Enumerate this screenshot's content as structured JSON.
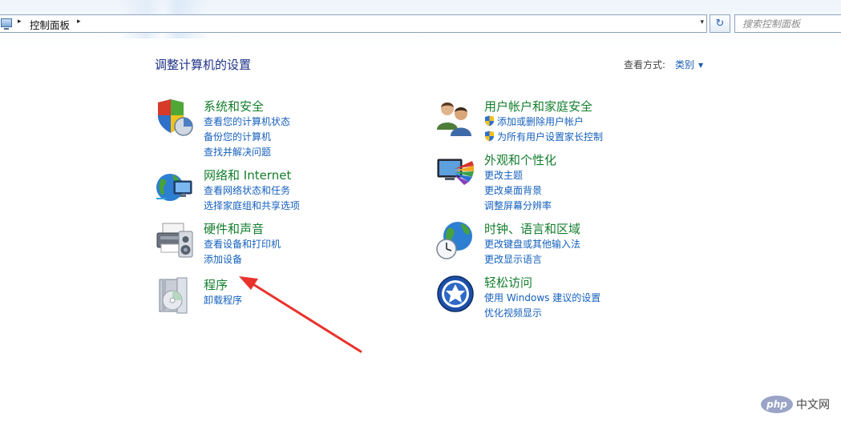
{
  "address_bar": {
    "breadcrumb": "控制面板",
    "separator": "▸",
    "dropdown": "▾"
  },
  "refresh_glyph": "↻",
  "search": {
    "placeholder": "搜索控制面板"
  },
  "page_title": "调整计算机的设置",
  "view_by": {
    "label": "查看方式:",
    "value": "类别"
  },
  "categories": [
    {
      "title": "系统和安全",
      "icon": "shield-pie-icon",
      "links": [
        "查看您的计算机状态",
        "备份您的计算机",
        "查找并解决问题"
      ]
    },
    {
      "title": "网络和 Internet",
      "icon": "globe-network-icon",
      "links": [
        "查看网络状态和任务",
        "选择家庭组和共享选项"
      ]
    },
    {
      "title": "硬件和声音",
      "icon": "printer-speaker-icon",
      "links": [
        "查看设备和打印机",
        "添加设备"
      ]
    },
    {
      "title": "程序",
      "icon": "programs-disc-icon",
      "links": [
        "卸载程序"
      ]
    },
    {
      "title": "用户帐户和家庭安全",
      "icon": "users-icon",
      "links": [
        "添加或删除用户帐户",
        "为所有用户设置家长控制"
      ]
    },
    {
      "title": "外观和个性化",
      "icon": "monitor-palette-icon",
      "links": [
        "更改主题",
        "更改桌面背景",
        "调整屏幕分辨率"
      ]
    },
    {
      "title": "时钟、语言和区域",
      "icon": "globe-clock-icon",
      "links": [
        "更改键盘或其他输入法",
        "更改显示语言"
      ]
    },
    {
      "title": "轻松访问",
      "icon": "accessibility-icon",
      "links": [
        "使用 Windows 建议的设置",
        "优化视频显示"
      ]
    }
  ],
  "colors": {
    "category_title": "#137e2d",
    "link": "#1560bd",
    "page_title": "#1e3287",
    "annotation_arrow": "#e8332c"
  },
  "watermark": {
    "logo": "php",
    "text": "中文网"
  }
}
